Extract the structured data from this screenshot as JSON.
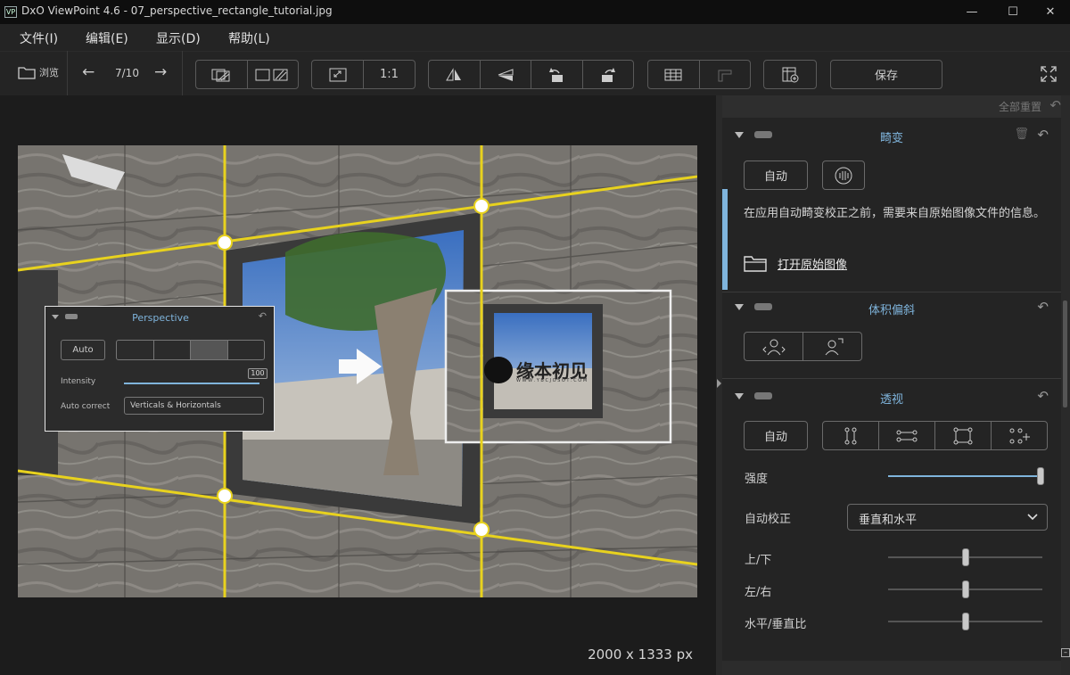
{
  "window": {
    "logo": "VP",
    "title": "DxO ViewPoint 4.6 - 07_perspective_rectangle_tutorial.jpg",
    "min_glyph": "—",
    "max_glyph": "☐",
    "close_glyph": "✕"
  },
  "menu": [
    "文件(I)",
    "编辑(E)",
    "显示(D)",
    "帮助(L)"
  ],
  "toolbar": {
    "browse_label": "浏览",
    "page_counter": "7/10",
    "zoom_one": "1:1",
    "save_label": "保存"
  },
  "canvas": {
    "image_size": "2000 x 1333 px",
    "overlay": {
      "title": "Perspective",
      "auto_label": "Auto",
      "intensity_label": "Intensity",
      "intensity_value": "100",
      "auto_correct_label": "Auto correct",
      "auto_correct_value": "Verticals & Horizontals"
    },
    "watermark": {
      "main": "缘本初见",
      "sub": "W W W . Y B C J O S O T . C O M"
    }
  },
  "panel": {
    "reset_all": "全部重置",
    "distortion": {
      "title": "畸变",
      "auto_label": "自动",
      "info": "在应用自动畸变校正之前，需要来自原始图像文件的信息。",
      "open_original": "打开原始图像"
    },
    "volume": {
      "title": "体积偏斜"
    },
    "perspective": {
      "title": "透视",
      "auto_label": "自动",
      "intensity_label": "强度",
      "intensity_value": 1.0,
      "auto_correct_label": "自动校正",
      "auto_correct_value": "垂直和水平",
      "up_down_label": "上/下",
      "up_down_value": 0.5,
      "left_right_label": "左/右",
      "left_right_value": 0.5,
      "ratio_label": "水平/垂直比",
      "ratio_value": 0.5
    }
  },
  "colors": {
    "accent": "#7fb4dc",
    "guide_line": "#e8d21e",
    "background": "#1a1a1a",
    "panel": "#242424"
  }
}
